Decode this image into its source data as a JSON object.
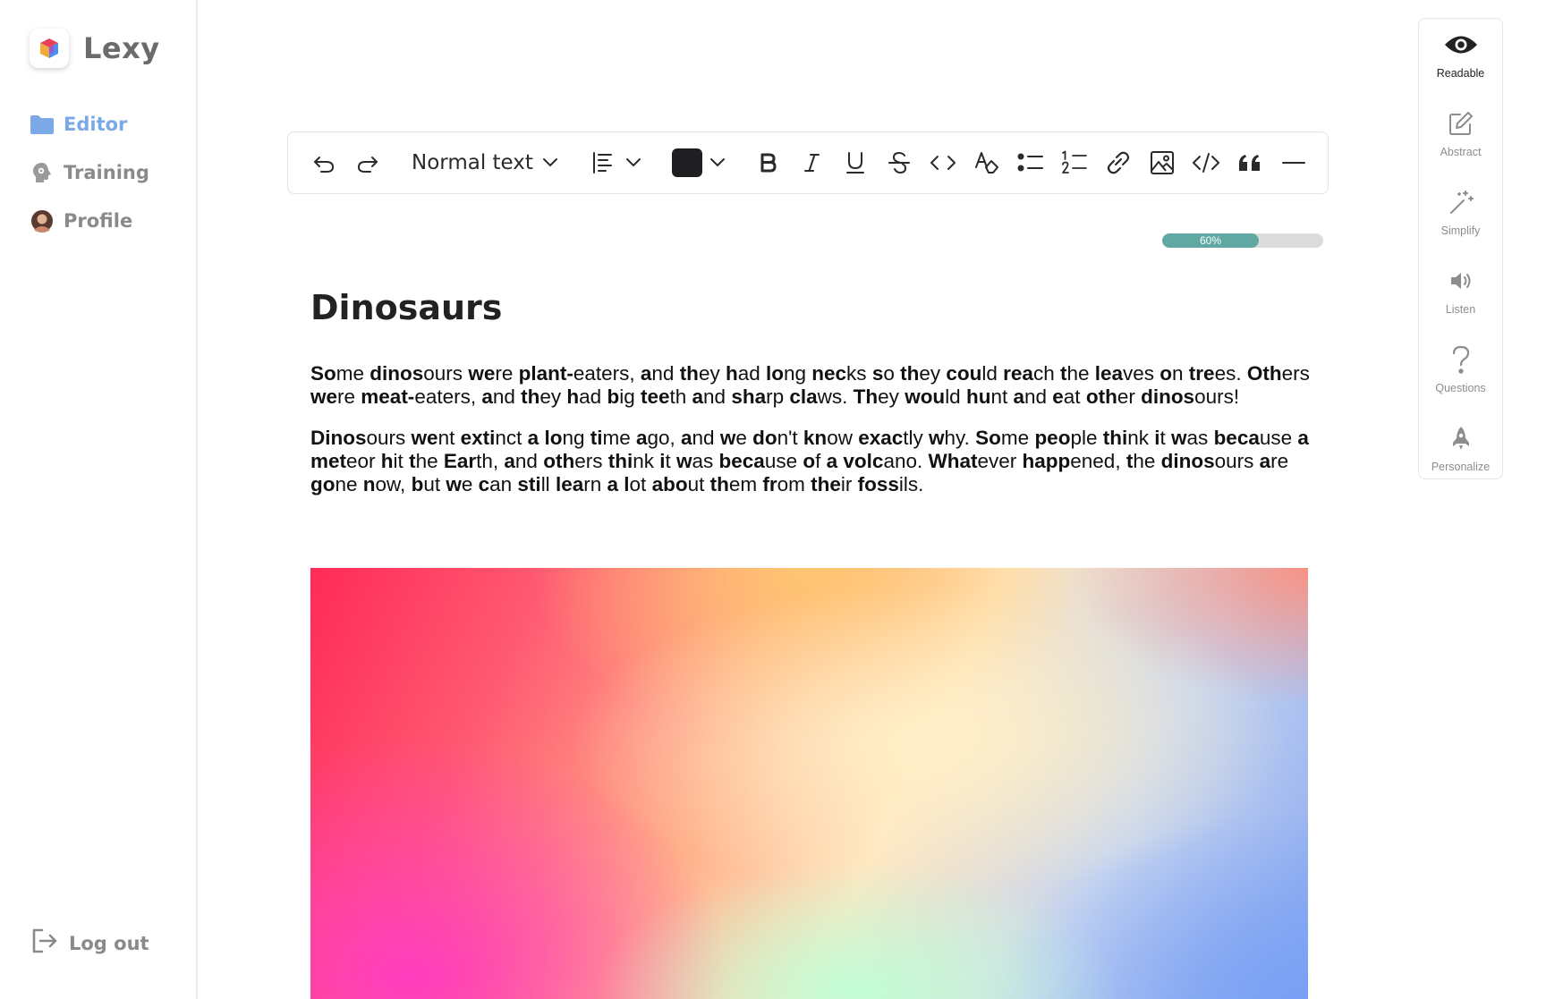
{
  "app": {
    "name": "Lexy"
  },
  "sidebar": {
    "items": [
      {
        "label": "Editor",
        "icon": "folder-icon",
        "active": true
      },
      {
        "label": "Training",
        "icon": "brain-icon",
        "active": false
      },
      {
        "label": "Profile",
        "icon": "avatar",
        "active": false
      }
    ],
    "logout_label": "Log out"
  },
  "toolbar": {
    "text_style": "Normal text",
    "text_color": "#1f1f22",
    "buttons": [
      "undo-icon",
      "redo-icon",
      "align-icon",
      "bold-icon",
      "italic-icon",
      "underline-icon",
      "strikethrough-icon",
      "inline-code-icon",
      "clear-format-icon",
      "bullet-list-icon",
      "numbered-list-icon",
      "link-icon",
      "image-icon",
      "code-block-icon",
      "quote-icon",
      "horizontal-rule-icon"
    ]
  },
  "progress": {
    "value": 0.6,
    "label": "60%",
    "color": "#5fa9a2"
  },
  "document": {
    "title": "Dinosaurs",
    "paragraphs": [
      "Some dinosours were plant-eaters, and they had long necks so they could reach the leaves on trees. Others were meat-eaters, and they had big teeth and sharp claws. They would hunt and eat other dinosours!",
      "Dinosours went extinct a long time ago, and we don't know exactly why. Some people think it was because a meteor hit the Earth, and others think it was because of a volcano. Whatever happened, the dinosours are gone now, but we can still learn a lot about them from their fossils."
    ]
  },
  "right_panel": {
    "items": [
      {
        "label": "Readable",
        "icon": "eye-icon",
        "active": true
      },
      {
        "label": "Abstract",
        "icon": "edit-icon",
        "active": false
      },
      {
        "label": "Simplify",
        "icon": "magic-wand-icon",
        "active": false
      },
      {
        "label": "Listen",
        "icon": "speaker-icon",
        "active": false
      },
      {
        "label": "Questions",
        "icon": "question-icon",
        "active": false
      },
      {
        "label": "Personalize",
        "icon": "rocket-icon",
        "active": false
      }
    ]
  },
  "colors": {
    "accent": "#7ba9e8",
    "muted": "#8a8a8a"
  }
}
